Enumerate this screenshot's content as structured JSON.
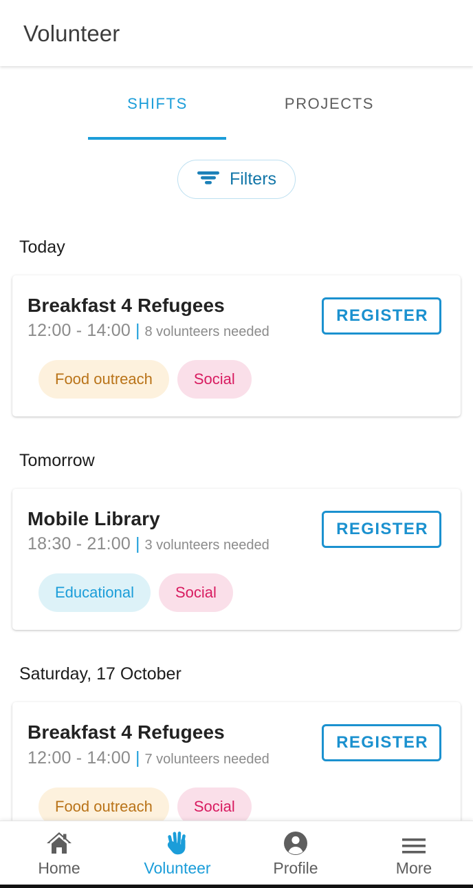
{
  "appbar": {
    "title": "Volunteer"
  },
  "tabs": [
    {
      "label": "SHIFTS",
      "active": true
    },
    {
      "label": "PROJECTS",
      "active": false
    }
  ],
  "filters": {
    "label": "Filters",
    "icon": "filter-icon"
  },
  "colors": {
    "accent": "#1b9dd9",
    "register_border": "#1b91cf",
    "tag_food_bg": "#fdf1dd",
    "tag_food_text": "#b97318",
    "tag_social_bg": "#fadfe9",
    "tag_social_text": "#d81b60",
    "tag_edu_bg": "#ddf2f8",
    "tag_edu_text": "#1b9dd9",
    "muted_text": "#8b8b8b",
    "title_text": "#222222"
  },
  "sections": [
    {
      "heading": "Today",
      "shifts": [
        {
          "title": "Breakfast 4 Refugees",
          "time": "12:00 - 14:00",
          "separator": "|",
          "volunteers_needed": "8 volunteers needed",
          "register_label": "REGISTER",
          "tags": [
            {
              "label": "Food outreach",
              "bg": "#fdf1dd",
              "fg": "#b97318"
            },
            {
              "label": "Social",
              "bg": "#fadfe9",
              "fg": "#d81b60"
            }
          ]
        }
      ]
    },
    {
      "heading": "Tomorrow",
      "shifts": [
        {
          "title": "Mobile Library",
          "time": "18:30 - 21:00",
          "separator": "|",
          "volunteers_needed": "3 volunteers needed",
          "register_label": "REGISTER",
          "tags": [
            {
              "label": "Educational",
              "bg": "#ddf2f8",
              "fg": "#1b9dd9"
            },
            {
              "label": "Social",
              "bg": "#fadfe9",
              "fg": "#d81b60"
            }
          ]
        }
      ]
    },
    {
      "heading": "Saturday, 17 October",
      "shifts": [
        {
          "title": "Breakfast 4 Refugees",
          "time": "12:00 - 14:00",
          "separator": "|",
          "volunteers_needed": "7 volunteers needed",
          "register_label": "REGISTER",
          "tags": [
            {
              "label": "Food outreach",
              "bg": "#fdf1dd",
              "fg": "#b97318"
            },
            {
              "label": "Social",
              "bg": "#fadfe9",
              "fg": "#d81b60"
            }
          ]
        }
      ]
    }
  ],
  "bottom_nav": [
    {
      "label": "Home",
      "icon": "home-icon",
      "active": false
    },
    {
      "label": "Volunteer",
      "icon": "raised-hand-icon",
      "active": true
    },
    {
      "label": "Profile",
      "icon": "person-circle-icon",
      "active": false
    },
    {
      "label": "More",
      "icon": "hamburger-menu-icon",
      "active": false
    }
  ]
}
